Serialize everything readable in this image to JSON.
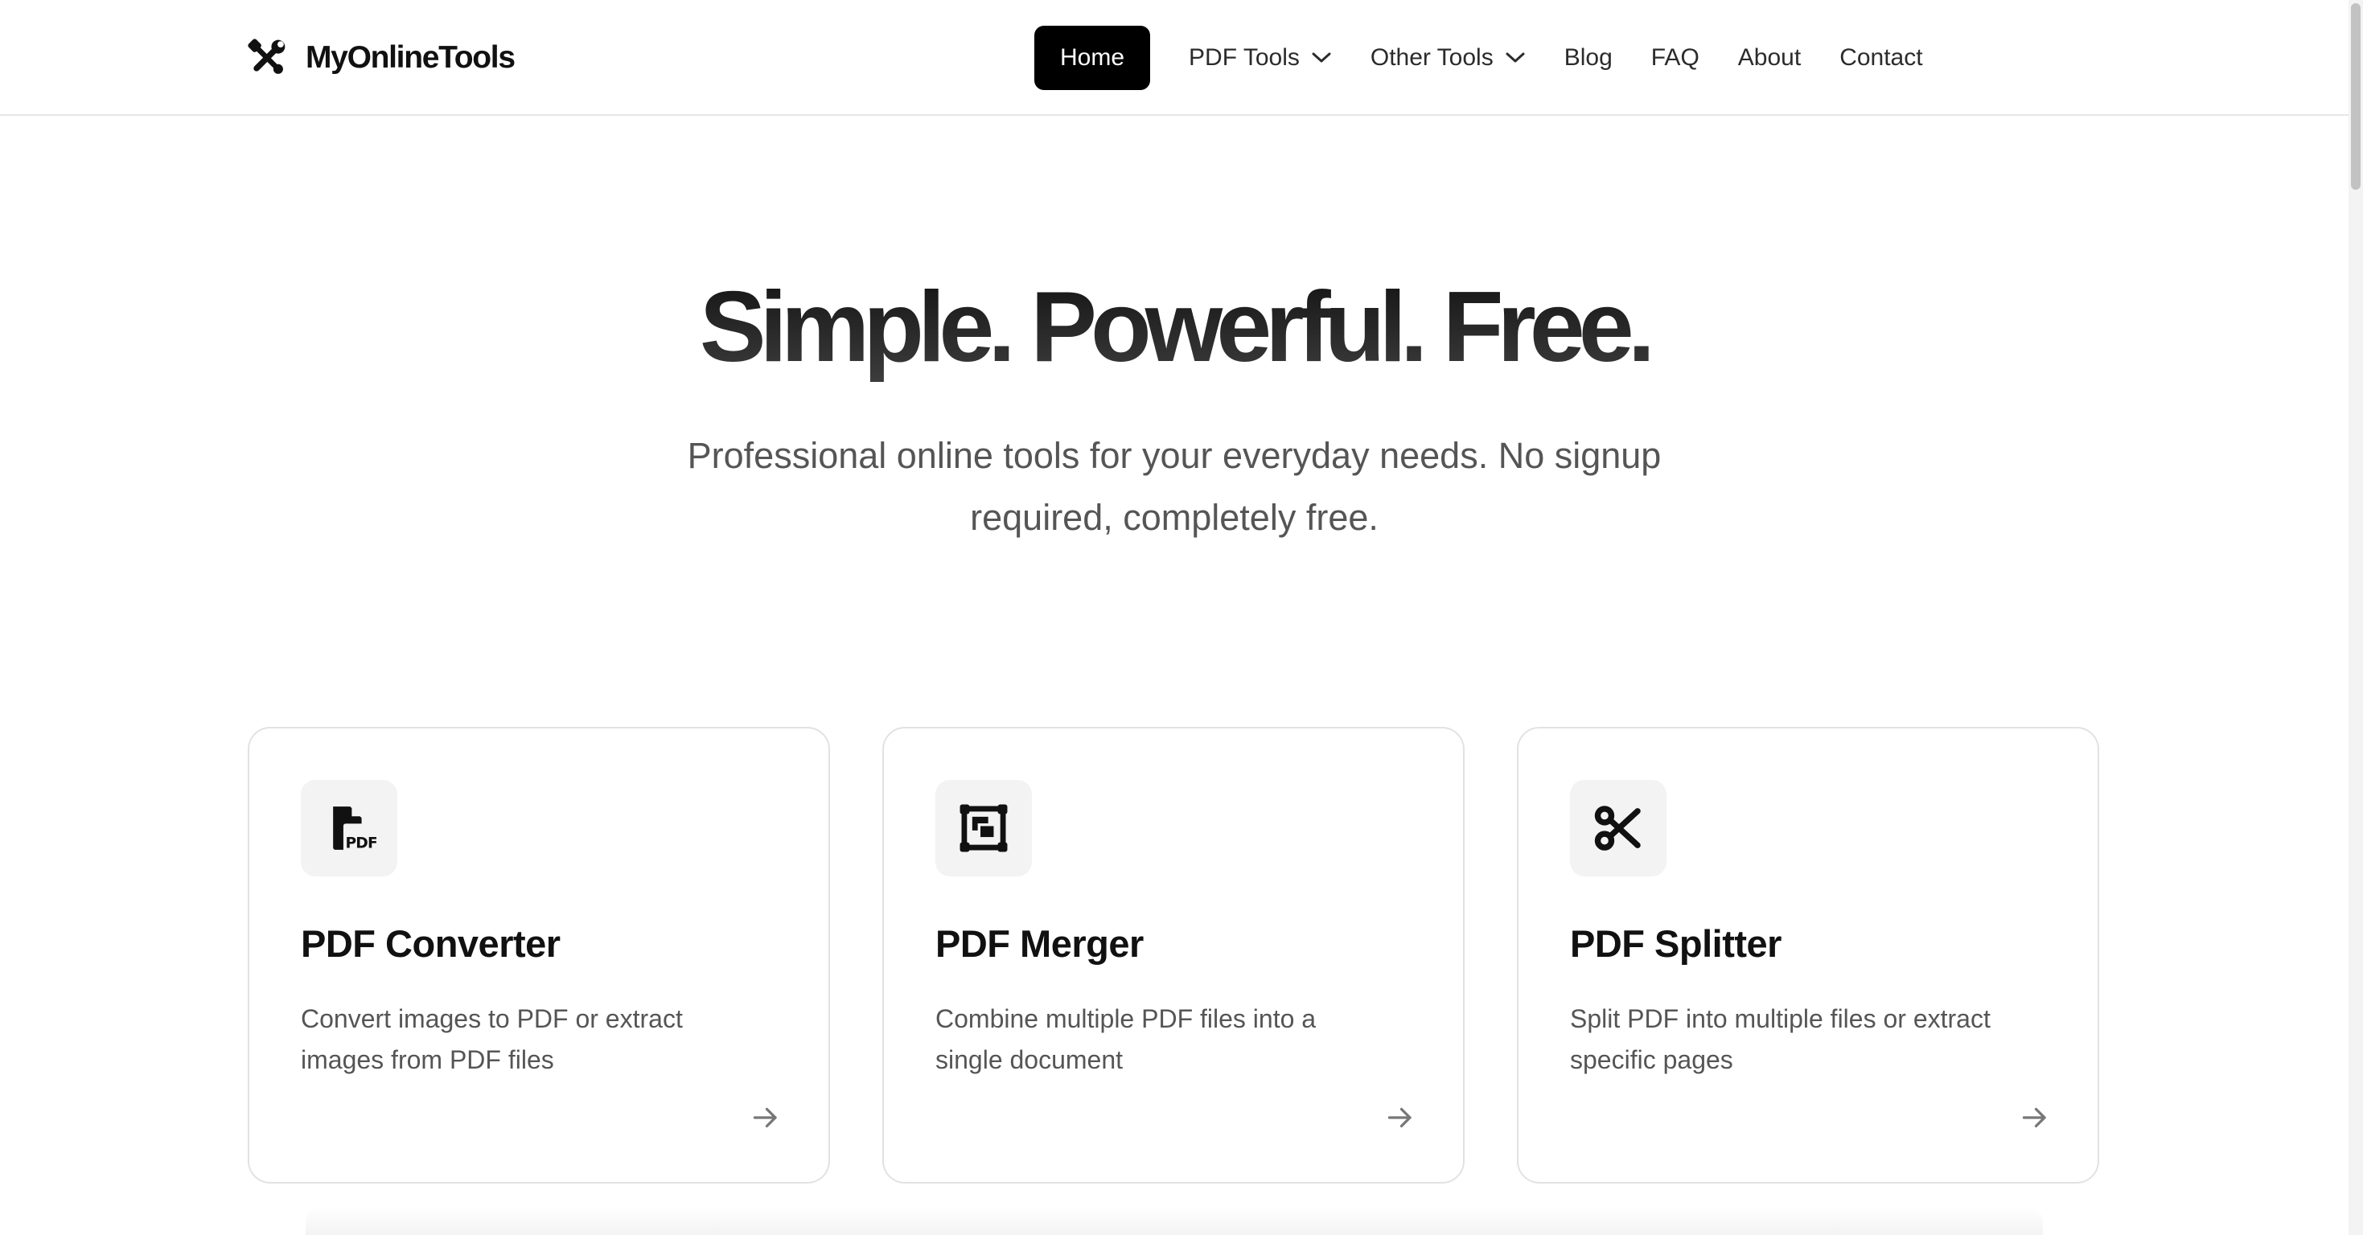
{
  "header": {
    "logo": {
      "icon": "tools-icon",
      "text": "MyOnlineTools"
    },
    "nav": [
      {
        "label": "Home",
        "active": true
      },
      {
        "label": "PDF Tools",
        "dropdown": true
      },
      {
        "label": "Other Tools",
        "dropdown": true
      },
      {
        "label": "Blog"
      },
      {
        "label": "FAQ"
      },
      {
        "label": "About"
      },
      {
        "label": "Contact"
      }
    ]
  },
  "hero": {
    "title": "Simple. Powerful. Free.",
    "subtitle": "Professional online tools for your everyday needs. No signup required, completely free."
  },
  "tools": [
    {
      "icon": "pdf-file-icon",
      "title": "PDF Converter",
      "description": "Convert images to PDF or extract images from PDF files"
    },
    {
      "icon": "merge-icon",
      "title": "PDF Merger",
      "description": "Combine multiple PDF files into a single document"
    },
    {
      "icon": "scissors-icon",
      "title": "PDF Splitter",
      "description": "Split PDF into multiple files or extract specific pages"
    }
  ],
  "colors": {
    "accent": "#000000",
    "text": "#111111",
    "muted": "#555555",
    "border": "#e2e2e2",
    "icon_bg": "#f3f3f3"
  }
}
